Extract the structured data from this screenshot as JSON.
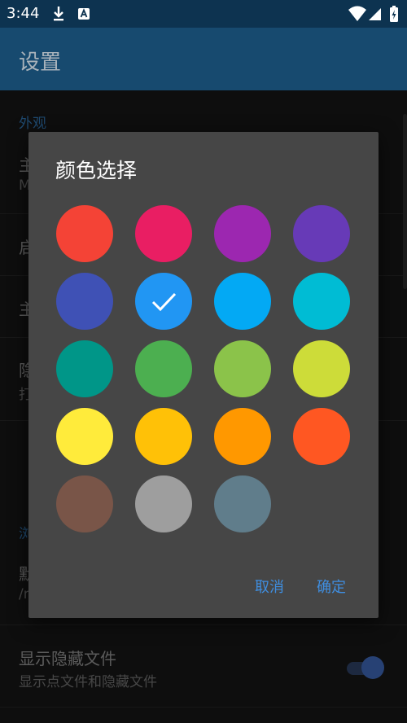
{
  "status_bar": {
    "time": "3:44"
  },
  "app_bar": {
    "title": "设置"
  },
  "settings": {
    "section_appearance": "外观",
    "row1_title": "主",
    "row1_sub": "M",
    "row2_title": "启",
    "row3_title": "主",
    "row4_title": "隐",
    "row4_sub": "打",
    "section_browse": "浏",
    "row5_title": "默",
    "row5_sub": "/r",
    "row6_title": "显示隐藏文件",
    "row6_sub": "显示点文件和隐藏文件",
    "row6_toggle_on": true
  },
  "dialog": {
    "title": "颜色选择",
    "cancel": "取消",
    "confirm": "确定",
    "selected_index": 5,
    "swatches": [
      "#f44336",
      "#e91e63",
      "#9c27b0",
      "#673ab7",
      "#3f51b5",
      "#2196f3",
      "#03a9f4",
      "#00bcd4",
      "#009688",
      "#4caf50",
      "#8bc34a",
      "#cddc39",
      "#ffeb3b",
      "#ffc107",
      "#ff9800",
      "#ff5722",
      "#795548",
      "#9e9e9e",
      "#607d8b"
    ]
  }
}
